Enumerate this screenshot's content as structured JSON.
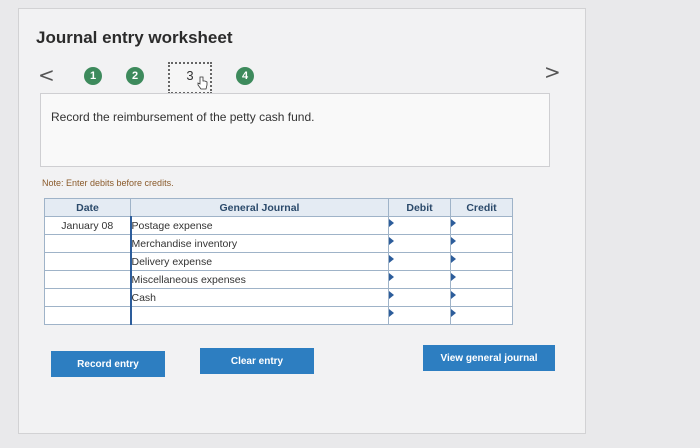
{
  "title": "Journal entry worksheet",
  "nav": {
    "prev": "<",
    "next": ">"
  },
  "steps": [
    "1",
    "2",
    "3",
    "4"
  ],
  "instruction": "Record the reimbursement of the petty cash fund.",
  "note": "Note: Enter debits before credits.",
  "table": {
    "headers": {
      "date": "Date",
      "general_journal": "General Journal",
      "debit": "Debit",
      "credit": "Credit"
    },
    "rows": [
      {
        "date": "January 08",
        "account": "Postage expense",
        "debit": "",
        "credit": ""
      },
      {
        "date": "",
        "account": "Merchandise inventory",
        "debit": "",
        "credit": ""
      },
      {
        "date": "",
        "account": "Delivery expense",
        "debit": "",
        "credit": ""
      },
      {
        "date": "",
        "account": "Miscellaneous expenses",
        "debit": "",
        "credit": ""
      },
      {
        "date": "",
        "account": "Cash",
        "debit": "",
        "credit": ""
      },
      {
        "date": "",
        "account": "",
        "debit": "",
        "credit": ""
      }
    ]
  },
  "buttons": {
    "record": "Record entry",
    "clear": "Clear entry",
    "view": "View general journal"
  },
  "colors": {
    "accent": "#2d7ec1",
    "step": "#3d8a5c",
    "header": "#e4ebf3"
  }
}
